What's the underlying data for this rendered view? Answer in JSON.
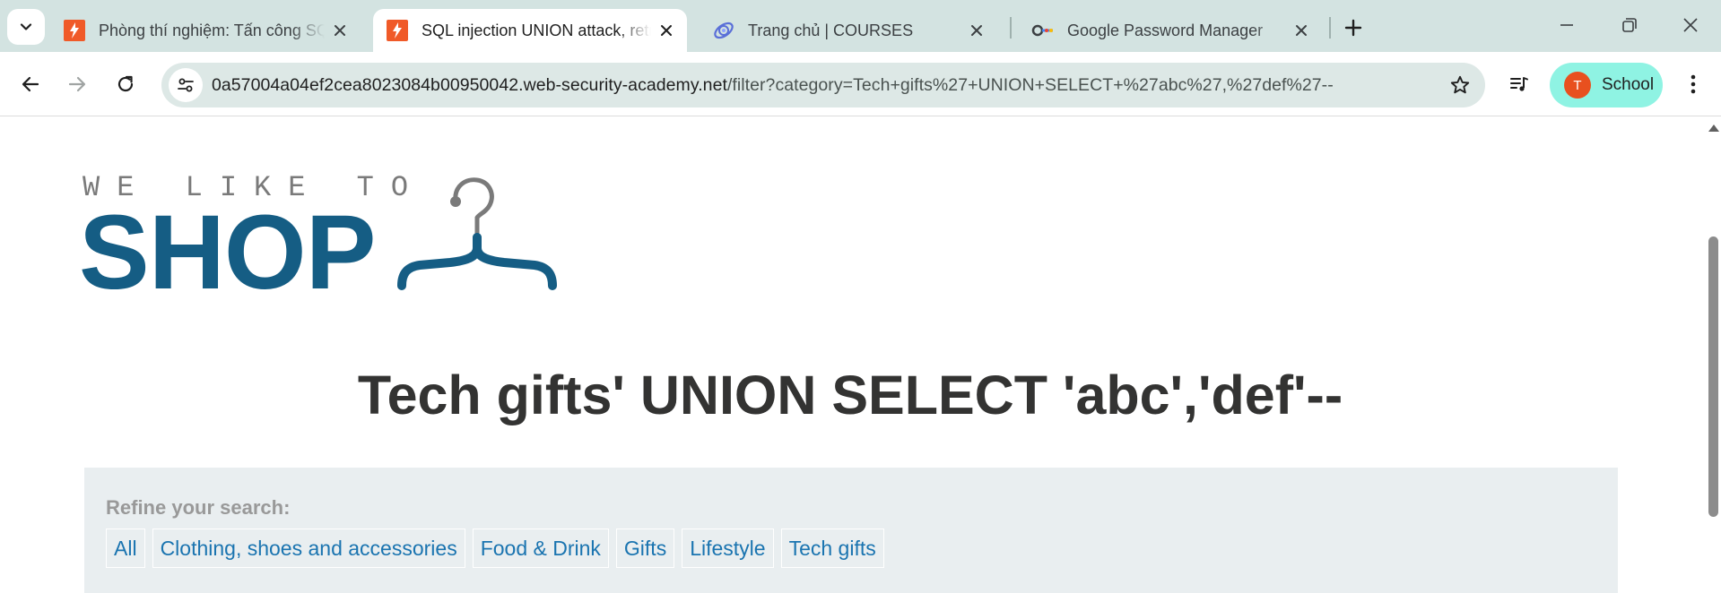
{
  "tabs": [
    {
      "title": "Phòng thí nghiệm: Tấn công SQL injection",
      "favicon": "portswigger-icon"
    },
    {
      "title": "SQL injection UNION attack, retrieving data",
      "favicon": "portswigger-icon"
    },
    {
      "title": "Trang chủ | COURSES",
      "favicon": "courses-icon"
    },
    {
      "title": "Google Password Manager",
      "favicon": "key-icon"
    }
  ],
  "omnibox": {
    "host": "0a57004a04ef2cea8023084b00950042.web-security-academy.net",
    "path": "/filter?category=Tech+gifts%27+UNION+SELECT+%27abc%27,%27def%27--"
  },
  "profile": {
    "initial": "T",
    "name": "School",
    "avatar_color": "#e8501f"
  },
  "page": {
    "logo_small": "WE LIKE TO",
    "logo_big": "SHOP",
    "heading": "Tech gifts' UNION SELECT 'abc','def'--",
    "refine_label": "Refine your search:",
    "filters": [
      "All",
      "Clothing, shoes and accessories",
      "Food & Drink",
      "Gifts",
      "Lifestyle",
      "Tech gifts"
    ]
  },
  "colors": {
    "tabstrip": "#d3e3e1",
    "logo_blue": "#155d84",
    "link_blue": "#1a74b0",
    "profile_chip": "#8ff3e3"
  }
}
